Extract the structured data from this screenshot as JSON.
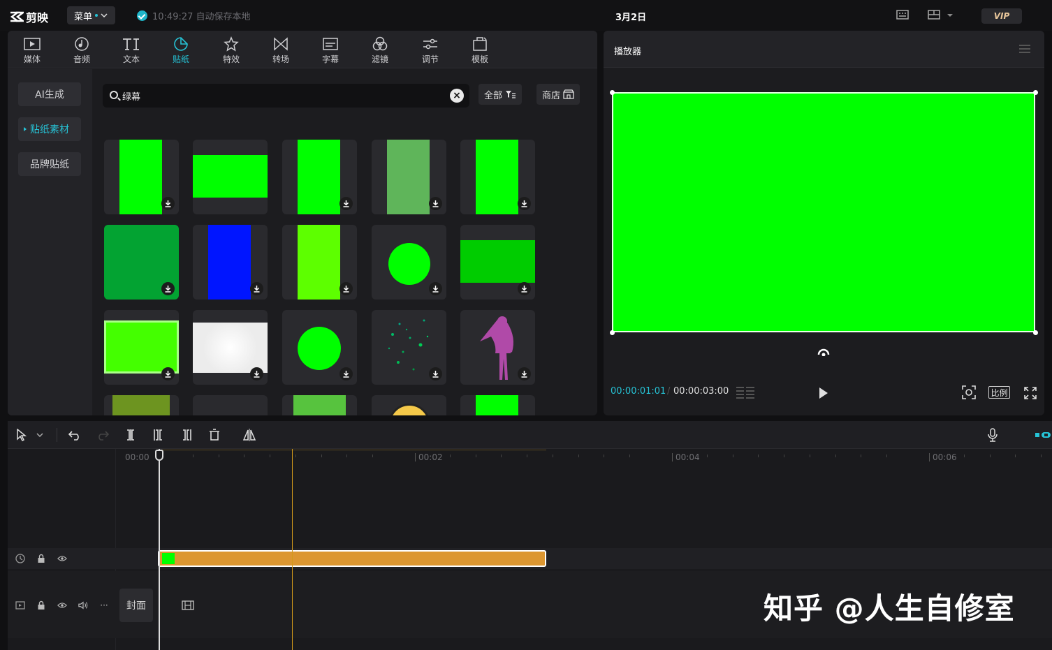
{
  "app": {
    "logo_text": "剪映",
    "menu_label": "菜单",
    "save_status": "10:49:27 自动保存本地",
    "project_title": "3月2日",
    "vip_label": "VIP"
  },
  "toolbar": {
    "tabs": [
      {
        "label": "媒体",
        "icon": "media-icon"
      },
      {
        "label": "音频",
        "icon": "audio-icon"
      },
      {
        "label": "文本",
        "icon": "text-icon",
        "glyph": "TI"
      },
      {
        "label": "贴纸",
        "icon": "sticker-icon",
        "active": true
      },
      {
        "label": "特效",
        "icon": "effects-icon"
      },
      {
        "label": "转场",
        "icon": "transition-icon"
      },
      {
        "label": "字幕",
        "icon": "subtitle-icon"
      },
      {
        "label": "滤镜",
        "icon": "filter-icon"
      },
      {
        "label": "调节",
        "icon": "adjust-icon"
      },
      {
        "label": "模板",
        "icon": "template-icon"
      }
    ]
  },
  "sidebar": {
    "items": [
      {
        "label": "AI生成"
      },
      {
        "label": "贴纸素材",
        "active": true
      },
      {
        "label": "品牌贴纸"
      }
    ]
  },
  "search": {
    "value": "绿幕",
    "filter_all": "全部",
    "store": "商店"
  },
  "player": {
    "title": "播放器",
    "current_time": "00:00:01:01",
    "separator": "/",
    "total_time": "00:00:03:00",
    "ratio_label": "比例",
    "preview_color": "#00ff00"
  },
  "timeline": {
    "ruler": [
      "00:00",
      "00:02",
      "00:04",
      "00:06"
    ],
    "cover_label": "封面",
    "clip_color": "#dc9630"
  },
  "colors": {
    "accent": "#26c3d6",
    "green_screen": "#00ff00"
  },
  "watermark": "知乎 @人生自修室"
}
